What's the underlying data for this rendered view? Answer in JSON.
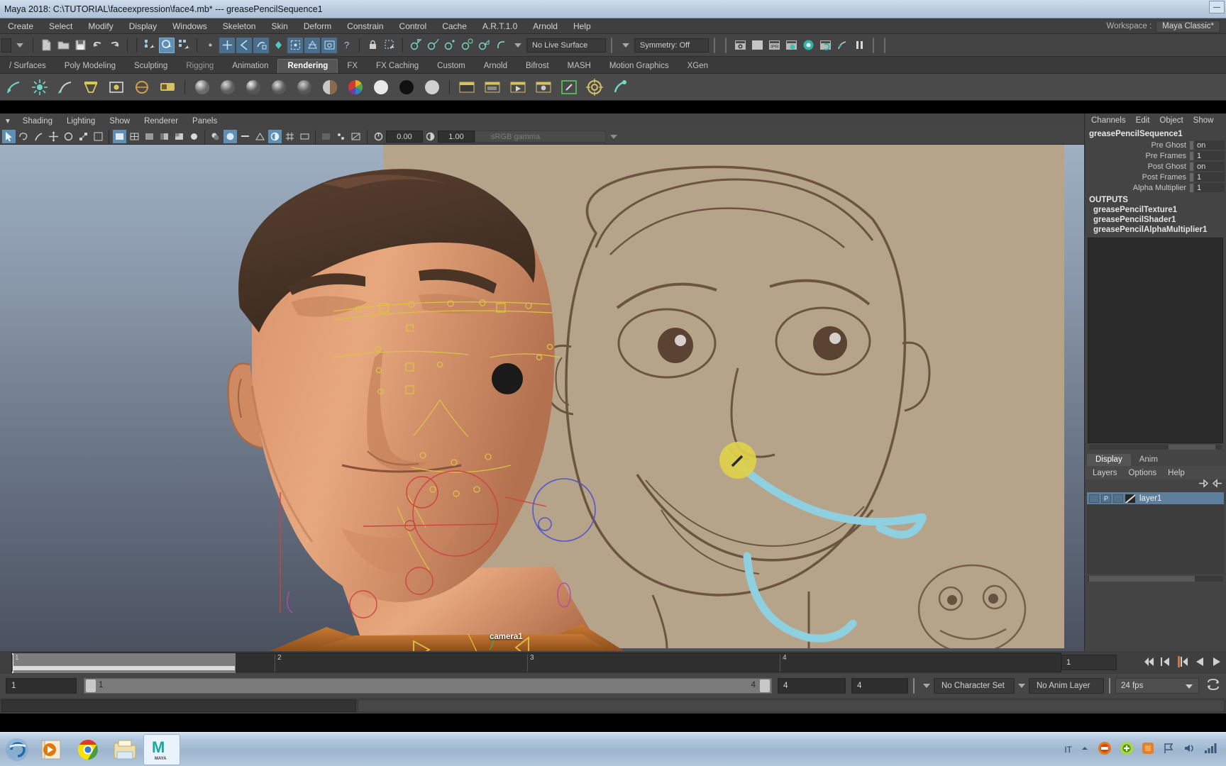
{
  "titlebar": {
    "title": "Maya 2018: C:\\TUTORIAL\\faceexpression\\face4.mb*   ---   greasePencilSequence1",
    "minimize": "—",
    "maximize": "❐",
    "close": "✕"
  },
  "menubar": {
    "items": [
      {
        "label": "Create"
      },
      {
        "label": "Select"
      },
      {
        "label": "Modify"
      },
      {
        "label": "Display"
      },
      {
        "label": "Windows"
      },
      {
        "label": "Skeleton"
      },
      {
        "label": "Skin"
      },
      {
        "label": "Deform"
      },
      {
        "label": "Constrain"
      },
      {
        "label": "Control"
      },
      {
        "label": "Cache"
      },
      {
        "label": "A.R.T.1.0"
      },
      {
        "label": "Arnold"
      },
      {
        "label": "Help"
      }
    ],
    "workspace_label": "Workspace :",
    "workspace_value": "Maya Classic*"
  },
  "statusline": {
    "live_surface": "No Live Surface",
    "symmetry": "Symmetry: Off"
  },
  "shelf_tabs": [
    {
      "label": "/ Surfaces",
      "active": false,
      "dim": false
    },
    {
      "label": "Poly Modeling",
      "active": false,
      "dim": false
    },
    {
      "label": "Sculpting",
      "active": false,
      "dim": false
    },
    {
      "label": "Rigging",
      "active": false,
      "dim": true
    },
    {
      "label": "Animation",
      "active": false,
      "dim": false
    },
    {
      "label": "Rendering",
      "active": true,
      "dim": false
    },
    {
      "label": "FX",
      "active": false,
      "dim": false
    },
    {
      "label": "FX Caching",
      "active": false,
      "dim": false
    },
    {
      "label": "Custom",
      "active": false,
      "dim": false
    },
    {
      "label": "Arnold",
      "active": false,
      "dim": false
    },
    {
      "label": "Bifrost",
      "active": false,
      "dim": false
    },
    {
      "label": "MASH",
      "active": false,
      "dim": false
    },
    {
      "label": "Motion Graphics",
      "active": false,
      "dim": false
    },
    {
      "label": "XGen",
      "active": false,
      "dim": false
    }
  ],
  "panel_menu": {
    "items": [
      {
        "label": "Shading"
      },
      {
        "label": "Lighting"
      },
      {
        "label": "Show"
      },
      {
        "label": "Renderer"
      },
      {
        "label": "Panels"
      }
    ]
  },
  "panel_toolbar": {
    "exposure_value": "0.00",
    "gamma_value": "1.00",
    "color_space": "sRGB gamma"
  },
  "viewport": {
    "camera_label": "camera1"
  },
  "channel_box": {
    "menu": [
      {
        "label": "Channels"
      },
      {
        "label": "Edit"
      },
      {
        "label": "Object"
      },
      {
        "label": "Show"
      }
    ],
    "node_name": "greasePencilSequence1",
    "attributes": [
      {
        "name": "Pre Ghost",
        "value": "on"
      },
      {
        "name": "Pre Frames",
        "value": "1"
      },
      {
        "name": "Post Ghost",
        "value": "on"
      },
      {
        "name": "Post Frames",
        "value": "1"
      },
      {
        "name": "Alpha Multiplier",
        "value": "1"
      }
    ],
    "outputs_header": "OUTPUTS",
    "outputs": [
      {
        "label": "greasePencilTexture1"
      },
      {
        "label": "greasePencilShader1"
      },
      {
        "label": "greasePencilAlphaMultiplier1"
      }
    ]
  },
  "layer_editor": {
    "tabs": [
      {
        "label": "Display",
        "active": true
      },
      {
        "label": "Anim",
        "active": false
      }
    ],
    "menu": [
      {
        "label": "Layers"
      },
      {
        "label": "Options"
      },
      {
        "label": "Help"
      }
    ],
    "layers": [
      {
        "name": "layer1",
        "visibility": "",
        "playback": "P",
        "reference": "",
        "selected": true
      }
    ]
  },
  "timeline": {
    "start_label": "1",
    "ticks": [
      {
        "label": "1",
        "pos": 0
      },
      {
        "label": "2",
        "pos": 25
      },
      {
        "label": "3",
        "pos": 49
      },
      {
        "label": "4",
        "pos": 73
      }
    ],
    "current_frame": "1"
  },
  "range_slider": {
    "start_field": "1",
    "anim_start": "1",
    "range_end_inner": "4",
    "anim_end": "4",
    "playback_end": "4",
    "character_set": "No Character Set",
    "anim_layer": "No Anim Layer",
    "fps": "24 fps"
  },
  "taskbar": {
    "items": [
      {
        "name": "internet-explorer",
        "active": false
      },
      {
        "name": "media-player",
        "active": false
      },
      {
        "name": "chrome",
        "active": false
      },
      {
        "name": "file-explorer",
        "active": false
      },
      {
        "name": "maya",
        "active": true,
        "label": "MAYA"
      }
    ],
    "tray_language": "IT"
  }
}
